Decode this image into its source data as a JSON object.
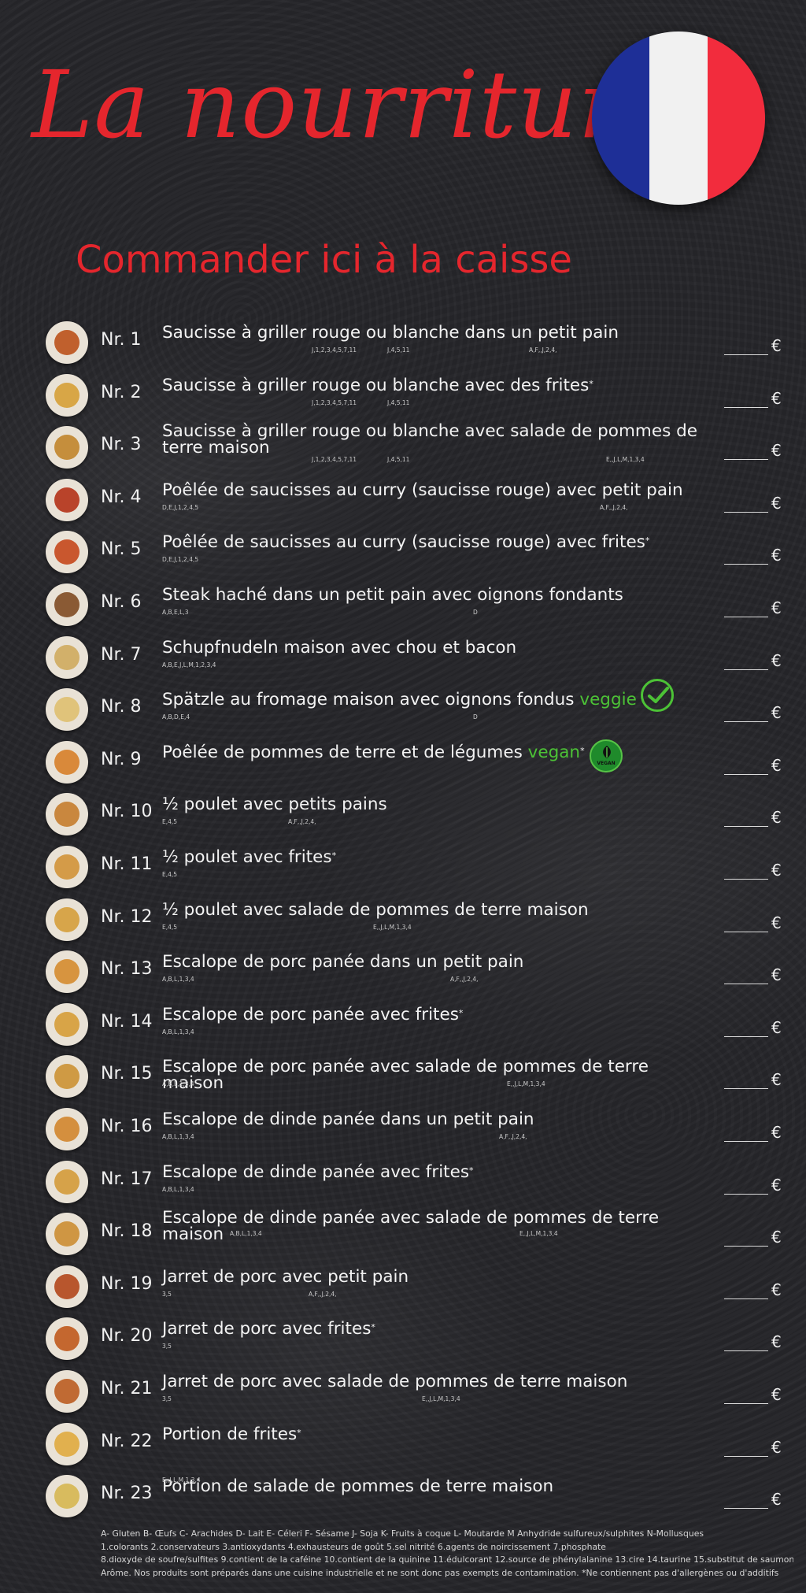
{
  "header": {
    "title": "La nourriture",
    "subtitle": "Commander ici à la caisse"
  },
  "colors": {
    "title_red": "#e5262d",
    "veggie_green": "#4cc236",
    "flag_blue": "#1e2f97",
    "flag_white": "#f1f1f1",
    "flag_red": "#f22c3d"
  },
  "currency": "€",
  "items": [
    {
      "nr": "Nr. 1",
      "name": "Saucisse à griller rouge ou blanche dans un petit pain",
      "codes": [
        "J,1,2,3,4,5,7,11",
        "J,4,5,11",
        "A,F,,J,2,4,"
      ],
      "food": "#c0602d"
    },
    {
      "nr": "Nr. 2",
      "name": "Saucisse à griller rouge ou blanche avec des frites",
      "star": "*",
      "codes": [
        "J,1,2,3,4,5,7,11",
        "J,4,5,11"
      ],
      "food": "#d8a646"
    },
    {
      "nr": "Nr. 3",
      "name": "Saucisse à griller rouge ou blanche avec salade de pommes de",
      "name2": "terre maison",
      "codes": [
        "J,1,2,3,4,5,7,11",
        "J,4,5,11",
        "E,,J,L,M,1,3,4"
      ],
      "food": "#c58e3c"
    },
    {
      "nr": "Nr. 4",
      "name": "Poêlée de saucisses au curry (saucisse rouge) avec petit pain",
      "codes": [
        "D,E,J,1,2,4,5",
        "A,F,,J,2,4,"
      ],
      "food": "#b9432a"
    },
    {
      "nr": "Nr. 5",
      "name": "Poêlée de saucisses au curry (saucisse rouge) avec frites",
      "star": "*",
      "codes": [
        "D,E,J,1,2,4,5"
      ],
      "food": "#c9572e"
    },
    {
      "nr": "Nr. 6",
      "name": "Steak haché dans un petit pain avec oignons fondants",
      "codes": [
        "A,B,E,L,3",
        "D"
      ],
      "food": "#8a5a34"
    },
    {
      "nr": "Nr. 7",
      "name": "Schupfnudeln maison avec chou et bacon",
      "codes": [
        "A,B,E,J,L,M,1,2,3,4"
      ],
      "food": "#d2b06a"
    },
    {
      "nr": "Nr. 8",
      "name": "Spätzle au fromage maison avec oignons fondus",
      "tag": "veggie",
      "codes": [
        "A,B,D,E,4",
        "D"
      ],
      "food": "#e0c37a"
    },
    {
      "nr": "Nr. 9",
      "name": "Poêlée de pommes de terre et de légumes",
      "tag": "vegan",
      "star": "*",
      "badge_text": "VEGAN",
      "codes": [],
      "food": "#d9893a"
    },
    {
      "nr": "Nr. 10",
      "name": "½ poulet avec petits pains",
      "codes": [
        "E,4,5",
        "A,F,,J,2,4,"
      ],
      "food": "#c9873e"
    },
    {
      "nr": "Nr. 11",
      "name": "½ poulet avec frites",
      "star": "*",
      "codes": [
        "E,4,5"
      ],
      "food": "#d49b48"
    },
    {
      "nr": "Nr. 12",
      "name": "½ poulet avec salade de pommes de terre maison",
      "codes": [
        "E,4,5",
        "E,,J,L,M,1,3,4"
      ],
      "food": "#d7a54a"
    },
    {
      "nr": "Nr. 13",
      "name": "Escalope de porc panée dans un petit pain",
      "codes": [
        "A,B,L,1,3,4",
        "A,F,,J,2,4,"
      ],
      "food": "#d7943f"
    },
    {
      "nr": "Nr. 14",
      "name": "Escalope de porc panée avec frites",
      "star": "*",
      "codes": [
        "A,B,L,1,3,4"
      ],
      "food": "#d8a447"
    },
    {
      "nr": "Nr. 15",
      "name": "Escalope de porc panée avec salade de pommes de terre maison",
      "codes": [
        "A,B,L,1,3,4",
        "E,,J,L,M,1,3,4"
      ],
      "food": "#cf9a44"
    },
    {
      "nr": "Nr. 16",
      "name": "Escalope de dinde panée dans un petit pain",
      "codes": [
        "A,B,L,1,3,4",
        "A,F,,J,2,4,"
      ],
      "food": "#d48f3e"
    },
    {
      "nr": "Nr. 17",
      "name": "Escalope de dinde panée avec frites",
      "star": "*",
      "codes": [
        "A,B,L,1,3,4"
      ],
      "food": "#d6a249"
    },
    {
      "nr": "Nr. 18",
      "name": "Escalope de dinde panée avec salade de pommes de terre",
      "name2": "maison",
      "codes": [
        "A,B,L,1,3,4",
        "E,,J,L,M,1,3,4"
      ],
      "food": "#cf9643"
    },
    {
      "nr": "Nr. 19",
      "name": "Jarret de porc avec petit pain",
      "codes": [
        "3,5",
        "A,F,,J,2,4,"
      ],
      "food": "#b8562d"
    },
    {
      "nr": "Nr. 20",
      "name": "Jarret de porc avec frites",
      "star": "*",
      "codes": [
        "3,5"
      ],
      "food": "#c4672f"
    },
    {
      "nr": "Nr. 21",
      "name": "Jarret de porc avec salade de pommes de terre maison",
      "codes": [
        "3,5",
        "E,,J,L,M,1,3,4"
      ],
      "food": "#c06a33"
    },
    {
      "nr": "Nr. 22",
      "name": "Portion de frites",
      "star": "*",
      "codes": [],
      "food": "#e1b04e"
    },
    {
      "nr": "Nr. 23",
      "name": "Portion de salade de pommes de terre maison",
      "codes": [
        "E,,J,L,M,1,3,4"
      ],
      "food": "#d8bb5e"
    }
  ],
  "footer": [
    "A- Gluten B- Œufs C- Arachides D- Lait E- Céleri F- Sésame J- Soja K- Fruits à coque L- Moutarde M Anhydride sulfureux/sulphites N-Mollusques",
    "1.colorants 2.conservateurs 3.antioxydants 4.exhausteurs de goût 5.sel nitrité 6.agents de noircissement 7.phosphate",
    "8.dioxyde de soufre/sulfites 9.contient de la caféine 10.contient de la quinine 11.édulcorant 12.source de phénylalanine 13.cire 14.taurine 15.substitut de saumon a.",
    "Arôme. Nos produits sont préparés dans une cuisine industrielle et ne sont donc pas exempts de contamination. *Ne contiennent pas d'allergènes ou d'additifs"
  ]
}
